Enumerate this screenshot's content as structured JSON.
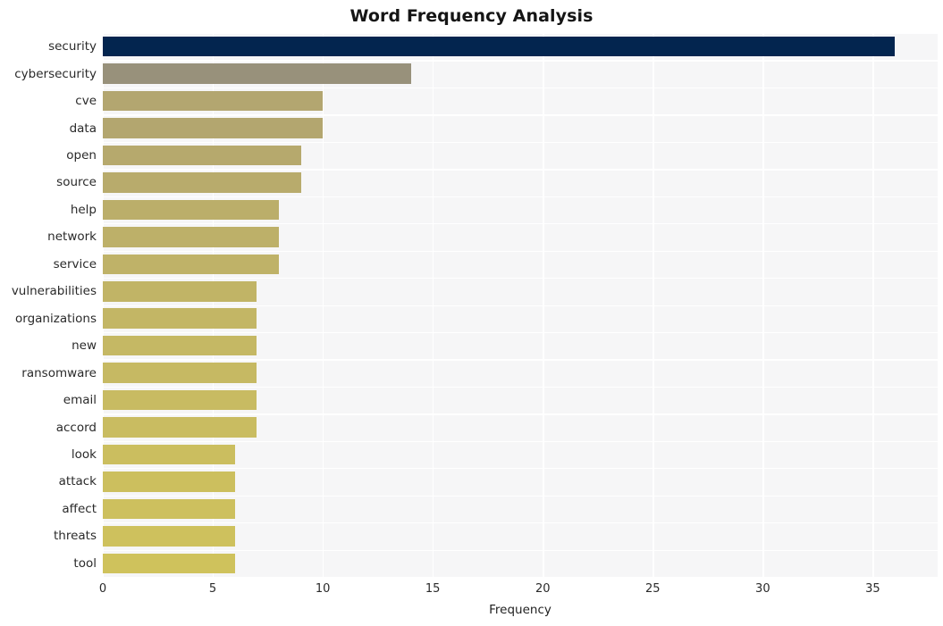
{
  "chart_data": {
    "type": "bar",
    "orientation": "horizontal",
    "title": "Word Frequency Analysis",
    "xlabel": "Frequency",
    "ylabel": "",
    "xlim": [
      0,
      37.95
    ],
    "xticks": [
      0,
      5,
      10,
      15,
      20,
      25,
      30,
      35
    ],
    "xticklabels": [
      "0",
      "5",
      "10",
      "15",
      "20",
      "25",
      "30",
      "35"
    ],
    "grid": "both-white-on-gray",
    "legend": null,
    "categories": [
      "security",
      "cybersecurity",
      "cve",
      "data",
      "open",
      "source",
      "help",
      "network",
      "service",
      "vulnerabilities",
      "organizations",
      "new",
      "ransomware",
      "email",
      "accord",
      "look",
      "attack",
      "affect",
      "threats",
      "tool"
    ],
    "values": [
      36,
      14,
      10,
      10,
      9,
      9,
      8,
      8,
      8,
      7,
      7,
      7,
      7,
      7,
      7,
      6,
      6,
      6,
      6,
      6
    ],
    "bar_colors": [
      "#03254f",
      "#98917b",
      "#b3a670",
      "#b3a66f",
      "#b6a96d",
      "#b8ab6c",
      "#bbae6a",
      "#bdb069",
      "#bfb268",
      "#c1b466",
      "#c3b665",
      "#c5b864",
      "#c6b963",
      "#c8bb62",
      "#c9bc61",
      "#cbbe5f",
      "#ccbf5e",
      "#cdc05e",
      "#cec15d",
      "#cfc25c"
    ],
    "plot_bgcolor": "#f6f6f7",
    "figure_bgcolor": "#ffffff",
    "gridline_color": "#ffffff",
    "title_color": "#151515",
    "tick_color": "#2a2a2a"
  }
}
